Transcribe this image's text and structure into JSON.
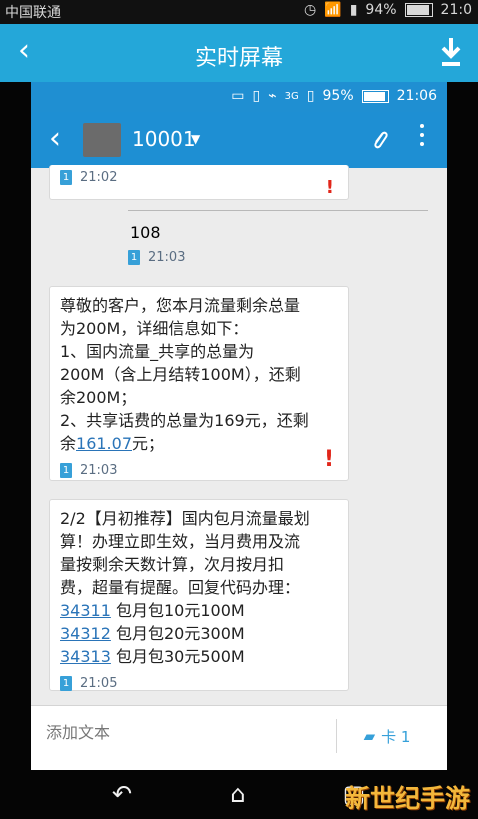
{
  "outer_status": {
    "carrier": "中国联通",
    "battery": "94%",
    "time": "21:0"
  },
  "outer_header": {
    "title": "实时屏幕"
  },
  "inner_status": {
    "battery": "95%",
    "time": "21:06",
    "network": "3G"
  },
  "conversation": {
    "contact": "10001"
  },
  "messages": [
    {
      "time": "21:02"
    },
    {
      "text": "108",
      "time": "21:03"
    },
    {
      "line1": "尊敬的客户，您本月流量剩余总量",
      "line2": "为200M，详细信息如下：",
      "line3": "1、国内流量_共享的总量为",
      "line4": "200M（含上月结转100M），还剩",
      "line5": "余200M；",
      "line6": "2、共享话费的总量为169元，还剩",
      "line7_prefix": "余",
      "line7_link": "161.07",
      "line7_suffix": "元；",
      "time": "21:03",
      "warning": "!"
    },
    {
      "line1": "2/2【月初推荐】国内包月流量最划",
      "line2": "算！办理立即生效，当月费用及流",
      "line3": "量按剩余天数计算，次月按月扣",
      "line4": "费，超量有提醒。回复代码办理：",
      "offers": [
        {
          "code": "34311",
          "text": "包月包10元100M"
        },
        {
          "code": "34312",
          "text": "包月包20元300M"
        },
        {
          "code": "34313",
          "text": "包月包30元500M"
        }
      ],
      "time": "21:05"
    }
  ],
  "input": {
    "placeholder": "添加文本",
    "send_label": "卡 1"
  },
  "watermark": "新世纪手游"
}
